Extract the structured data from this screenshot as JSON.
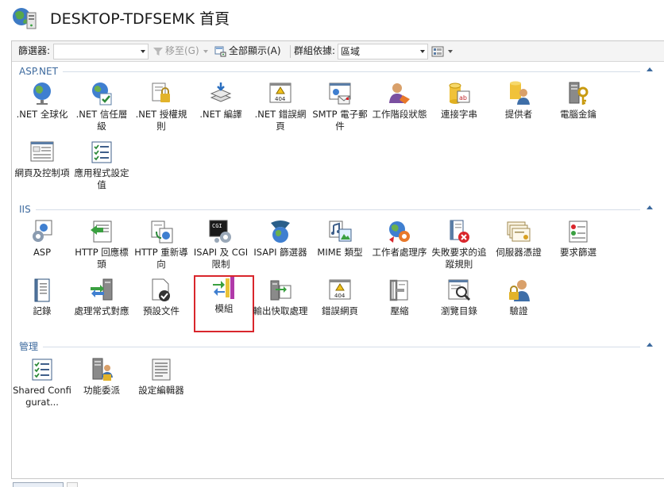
{
  "header": {
    "title": "DESKTOP-TDFSEMK 首頁",
    "icon": "server-globe-icon"
  },
  "toolbar": {
    "filter_label": "篩選器:",
    "filter_value": "",
    "go_label": "移至(G)",
    "show_all_label": "全部顯示(A)",
    "group_by_label": "群組依據:",
    "group_by_value": "區域"
  },
  "sections": [
    {
      "title": "ASP.NET",
      "tiles": [
        {
          "label": ".NET 全球化",
          "icon": "globe-icon"
        },
        {
          "label": ".NET 信任層級",
          "icon": "trust-globe-icon"
        },
        {
          "label": ".NET 授權規則",
          "icon": "lock-document-icon"
        },
        {
          "label": ".NET 編譯",
          "icon": "compile-layers-icon"
        },
        {
          "label": ".NET 錯誤網頁",
          "icon": "error-page-icon"
        },
        {
          "label": "SMTP 電子郵件",
          "icon": "smtp-mail-icon"
        },
        {
          "label": "工作階段狀態",
          "icon": "session-user-icon"
        },
        {
          "label": "連接字串",
          "icon": "database-icon"
        },
        {
          "label": "提供者",
          "icon": "provider-icon"
        },
        {
          "label": "電腦金鑰",
          "icon": "machine-key-icon"
        },
        {
          "label": "網頁及控制項",
          "icon": "page-controls-icon"
        },
        {
          "label": "應用程式設定值",
          "icon": "settings-list-icon"
        }
      ]
    },
    {
      "title": "IIS",
      "tiles": [
        {
          "label": "ASP",
          "icon": "asp-gear-icon"
        },
        {
          "label": "HTTP 回應標頭",
          "icon": "http-headers-icon"
        },
        {
          "label": "HTTP 重新導向",
          "icon": "redirect-icon"
        },
        {
          "label": "ISAPI 及 CGI 限制",
          "icon": "cgi-console-icon"
        },
        {
          "label": "ISAPI 篩選器",
          "icon": "filter-icon"
        },
        {
          "label": "MIME 類型",
          "icon": "mime-icon"
        },
        {
          "label": "工作者處理序",
          "icon": "worker-process-icon"
        },
        {
          "label": "失敗要求的追蹤規則",
          "icon": "failed-trace-icon"
        },
        {
          "label": "伺服器憑證",
          "icon": "certificate-icon"
        },
        {
          "label": "要求篩選",
          "icon": "request-filter-icon"
        },
        {
          "label": "記錄",
          "icon": "logging-icon"
        },
        {
          "label": "處理常式對應",
          "icon": "handler-mapping-icon"
        },
        {
          "label": "預設文件",
          "icon": "default-document-icon"
        },
        {
          "label": "模組",
          "icon": "modules-icon"
        },
        {
          "label": "輸出快取處理",
          "icon": "output-cache-icon"
        },
        {
          "label": "錯誤網頁",
          "icon": "error-pages-icon"
        },
        {
          "label": "壓縮",
          "icon": "compression-icon"
        },
        {
          "label": "瀏覽目錄",
          "icon": "directory-browsing-icon"
        },
        {
          "label": "驗證",
          "icon": "authentication-icon"
        }
      ]
    },
    {
      "title": "管理",
      "tiles": [
        {
          "label": "Shared Configurat...",
          "icon": "shared-config-icon"
        },
        {
          "label": "功能委派",
          "icon": "feature-delegation-icon"
        },
        {
          "label": "設定編輯器",
          "icon": "config-editor-icon"
        }
      ]
    }
  ],
  "colors": {
    "section_title": "#3d6a9e",
    "selection_border": "#d9262c"
  }
}
